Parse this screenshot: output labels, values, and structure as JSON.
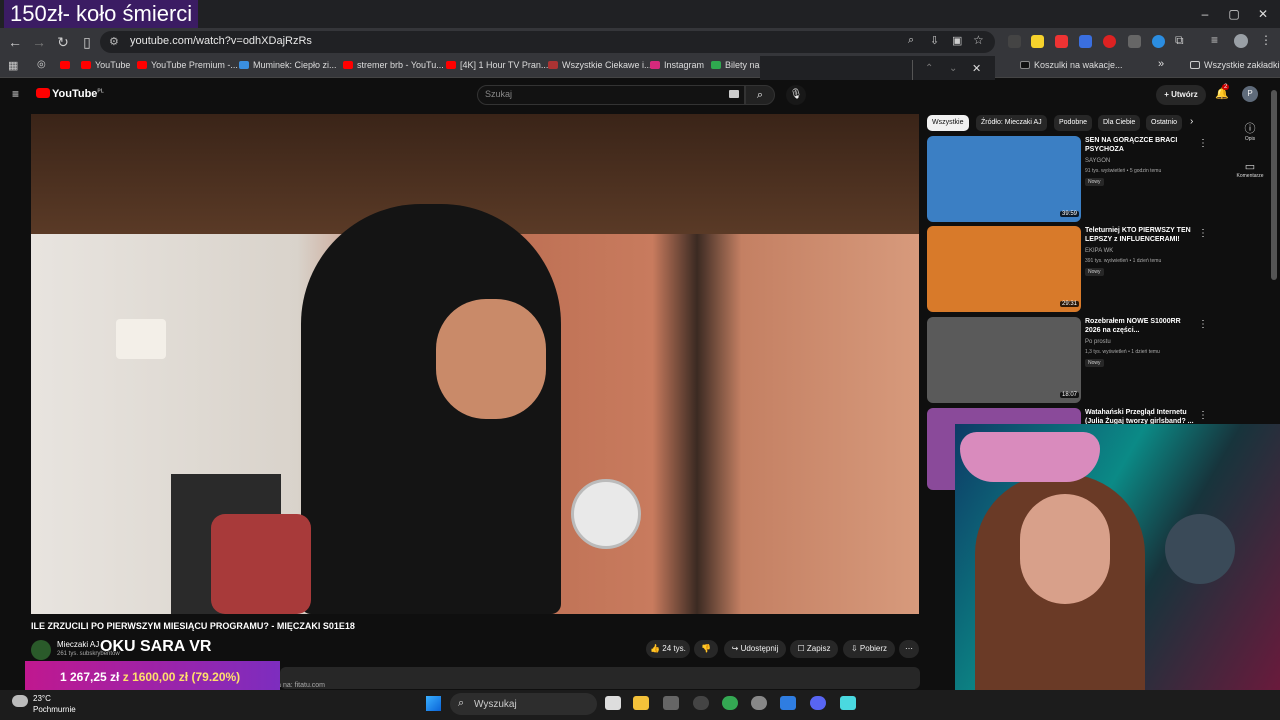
{
  "stream_title": "150zł- koło śmierci",
  "browser": {
    "url": "youtube.com/watch?v=odhXDajRzRs",
    "bookmarks": [
      "YouTube",
      "YouTube Premium -...",
      "Muminek: Ciepło zi...",
      "stremer brb - YouTu...",
      "[4K] 1 Hour TV Pran...",
      "Wszystkie Ciekawe i...",
      "Instagram",
      "Bilety na",
      "Koszulki na wakacje...",
      "Wszystkie zakładki"
    ],
    "window_controls": [
      "–",
      "▢",
      "✕"
    ]
  },
  "youtube": {
    "logo": "YouTube",
    "logo_region": "PL",
    "search_placeholder": "Szukaj",
    "create_label": "Utwórz",
    "notification_count": "2",
    "avatar_letter": "P",
    "video_title": "ILE ZRZUCILI PO PIERWSZYM MIESIĄCU PROGRAMU? - MIĘCZAKI S01E18",
    "channel_name": "Mieczaki AJ",
    "subscribers": "261 tys. subskrybentów",
    "overlay_text": "OKU SARA VR",
    "actions": {
      "likes": "24 tys.",
      "share": "Udostępnij",
      "save": "Zapisz",
      "download": "Pobierz"
    },
    "chips": [
      "Wszystkie",
      "Źródło: Mieczaki AJ",
      "Podobne",
      "Dla Ciebie",
      "Ostatnio"
    ],
    "rail": {
      "description": "Opis",
      "comments": "Komentarze"
    },
    "recommendations": [
      {
        "title": "SEN NA GORĄCZCE BRACI PSYCHOZA",
        "channel": "SAYGON",
        "meta": "91 tys. wyświetleń • 5 godzin temu",
        "badge": "Nowy",
        "duration": "39:59",
        "color": "#3b7fc4"
      },
      {
        "title": "Teleturniej KTO PIERWSZY TEN LEPSZY z INFLUENCERAMI!",
        "channel": "EKIPA WK",
        "meta": "391 tys. wyświetleń • 1 dzień temu",
        "badge": "Nowy",
        "duration": "29:31",
        "color": "#d87a2a"
      },
      {
        "title": "Rozebrałem NOWE S1000RR 2026 na części...",
        "channel": "Po prostu",
        "meta": "1,3 tys. wyświetleń • 1 dzień temu",
        "badge": "Nowy",
        "duration": "18:07",
        "color": "#5a5a5a"
      },
      {
        "title": "Watahański Przegląd Internetu (Julia Żugaj tworzy girlsband? ...",
        "channel": "",
        "meta": "",
        "badge": "",
        "duration": "",
        "color": "#8a4a9a"
      }
    ]
  },
  "donation_goal": {
    "current": "1 267,25 zł",
    "separator": "z",
    "target": "1600,00 zł",
    "percent": "(79.20%)"
  },
  "description_note": "do podziękowania na: fitatu.com",
  "taskbar": {
    "temperature": "23°C",
    "weather": "Pochmurnie",
    "search_placeholder": "Wyszukaj"
  }
}
